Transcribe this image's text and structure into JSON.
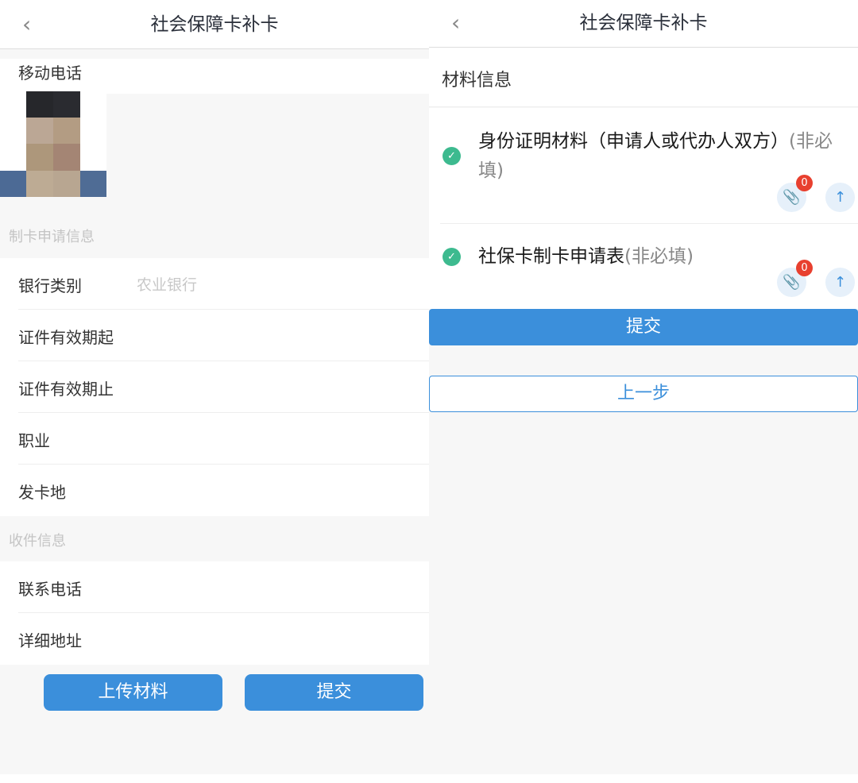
{
  "left": {
    "title": "社会保障卡补卡",
    "mobile_label": "移动电话",
    "section_card": "制卡申请信息",
    "rows": [
      {
        "label": "银行类别",
        "value": "农业银行"
      },
      {
        "label": "证件有效期起"
      },
      {
        "label": "证件有效期止"
      },
      {
        "label": "职业"
      },
      {
        "label": "发卡地"
      }
    ],
    "section_delivery": "收件信息",
    "delivery_rows": [
      {
        "label": "联系电话"
      },
      {
        "label": "详细地址"
      }
    ],
    "upload_button": "上传材料",
    "submit_button": "提交"
  },
  "right": {
    "title": "社会保障卡补卡",
    "section": "材料信息",
    "items": [
      {
        "title": "身份证明材料（申请人或代办人双方）",
        "optional": "(非必填)",
        "count": "0"
      },
      {
        "title": "社保卡制卡申请表",
        "optional": "(非必填)",
        "count": "0"
      }
    ],
    "submit_button": "提交",
    "prev_button": "上一步"
  },
  "colors": {
    "primary": "#3b8fdb",
    "success": "#3dba8f",
    "badge": "#e8402f"
  }
}
